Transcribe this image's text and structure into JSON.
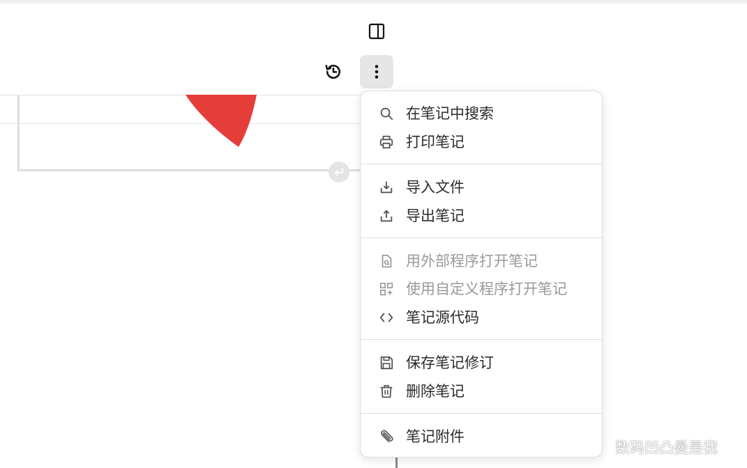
{
  "toolbar": {
    "panel_toggle_icon": "sidebar-right-icon",
    "history_icon": "history-icon",
    "more_icon": "more-vertical-icon"
  },
  "canvas": {
    "shape_color": "#e53e3a",
    "enter_icon": "return-arrow-icon"
  },
  "menu": {
    "groups": [
      [
        {
          "label": "在笔记中搜索",
          "icon": "search-icon",
          "enabled": true
        },
        {
          "label": "打印笔记",
          "icon": "printer-icon",
          "enabled": true
        }
      ],
      [
        {
          "label": "导入文件",
          "icon": "import-icon",
          "enabled": true
        },
        {
          "label": "导出笔记",
          "icon": "export-icon",
          "enabled": true
        }
      ],
      [
        {
          "label": "用外部程序打开笔记",
          "icon": "file-search-icon",
          "enabled": false
        },
        {
          "label": "使用自定义程序打开笔记",
          "icon": "apps-add-icon",
          "enabled": false
        },
        {
          "label": "笔记源代码",
          "icon": "code-icon",
          "enabled": true
        }
      ],
      [
        {
          "label": "保存笔记修订",
          "icon": "save-icon",
          "enabled": true
        },
        {
          "label": "删除笔记",
          "icon": "trash-icon",
          "enabled": true
        }
      ],
      [
        {
          "label": "笔记附件",
          "icon": "paperclip-icon",
          "enabled": true
        }
      ]
    ]
  },
  "watermark": {
    "text": "数码凹凸曼是我"
  }
}
